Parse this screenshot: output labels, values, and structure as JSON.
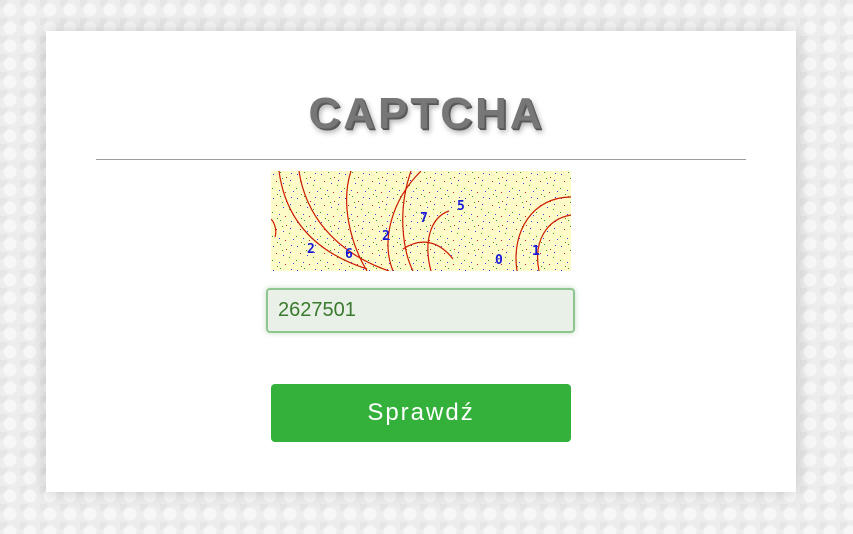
{
  "form": {
    "title": "CAPTCHA",
    "captcha_image": {
      "digits": [
        "2",
        "6",
        "2",
        "7",
        "5",
        "0",
        "1"
      ]
    },
    "code_input": {
      "value": "2627501"
    },
    "submit_label": "Sprawdź"
  },
  "colors": {
    "button": "#34b13b",
    "input_background": "#e8f0e7",
    "captcha_background": "#fdfcc9",
    "captcha_digits": "#1a1ad6",
    "captcha_arcs": "#cc1a00"
  }
}
